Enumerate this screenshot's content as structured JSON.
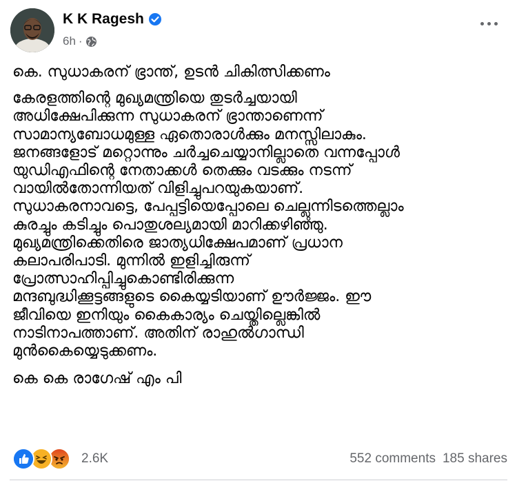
{
  "post": {
    "author_name": "K K Ragesh",
    "timestamp": "6h",
    "privacy_icon": "globe-icon",
    "title": "കെ. സുധാകരന് ഭ്രാന്ത്, ഉടൻ ചികിത്സിക്കണം",
    "body_lines": [
      "കേരളത്തിന്റെ മുഖ്യമന്ത്രിയെ തുടർച്ചയായി",
      "അധിക്ഷേപിക്കുന്ന സുധാകരന് ഭ്രാന്താണെന്ന്",
      "സാമാന്യബോധമുള്ള ഏതൊരാൾക്കും മനസ്സിലാകും.",
      "ജനങ്ങളോട് മറ്റൊന്നും ചർച്ചചെയ്യാനില്ലാതെ വന്നപ്പോൾ",
      "യുഡിഎഫിന്റെ നേതാക്കൾ തെക്കും വടക്കും നടന്ന്",
      "വായിൽതോന്നിയത് വിളിച്ചുപറയുകയാണ്.",
      "സുധാകരനാവട്ടെ, പേപ്പട്ടിയെപ്പോലെ ചെല്ലുന്നിടത്തെല്ലാം",
      "കുരച്ചും കടിച്ചും പൊതുശല്യമായി മാറിക്കഴിഞ്ഞു.",
      "മുഖ്യമന്ത്രിക്കെതിരെ ജാത്യധിക്ഷേപമാണ് പ്രധാന",
      "കലാപരിപാടി. മുന്നിൽ ഇളിച്ചിരുന്ന്",
      "പ്രോത്സാഹിപ്പിച്ചുകൊണ്ടിരിക്കുന്ന",
      "മന്ദബുദ്ധിക്കൂട്ടങ്ങളുടെ കൈയ്യടിയാണ് ഊർജ്ജം. ഈ",
      "ജീവിയെ ഇനിയും കൈകാര്യം ചെയ്തില്ലെങ്കിൽ",
      "നാടിനാപത്താണ്. അതിന് രാഹുൽഗാന്ധി",
      "മുൻകൈയ്യെടുക്കണം."
    ],
    "signature": "കെ കെ രാഗേഷ് എം പി"
  },
  "footer": {
    "reaction_count": "2.6K",
    "comments": "552 comments",
    "shares": "185 shares"
  },
  "colors": {
    "like": "#1877f2",
    "haha": "#f7b125",
    "angry": "#e9710f",
    "muted_text": "#65676b"
  }
}
